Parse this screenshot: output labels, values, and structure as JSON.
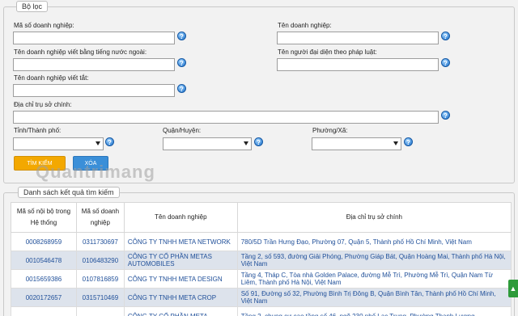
{
  "filter": {
    "legend": "Bộ lọc",
    "tax_code_label": "Mã số doanh nghiệp:",
    "name_label": "Tên doanh nghiệp:",
    "foreign_name_label": "Tên doanh nghiệp viết bằng tiếng nước ngoài:",
    "rep_label": "Tên người đại diện theo pháp luật:",
    "short_name_label": "Tên doanh nghiệp viết tắt:",
    "address_label": "Địa chỉ trụ sở chính:",
    "province_label": "Tỉnh/Thành phố:",
    "district_label": "Quận/Huyện:",
    "ward_label": "Phường/Xã:",
    "search_button": "TÌM KIẾM",
    "clear_button": "XÓA",
    "help_glyph": "?"
  },
  "watermark": "Quantrimang",
  "results": {
    "legend": "Danh sách kết quả tìm kiếm",
    "headers": [
      "Mã số nội bộ trong Hệ thống",
      "Mã số doanh nghiệp",
      "Tên doanh nghiệp",
      "Địa chỉ trụ sở chính"
    ],
    "rows": [
      [
        "0008268959",
        "0311730697",
        "CÔNG TY TNHH META NETWORK",
        "780/5D Trần Hưng Đạo, Phường 07, Quận 5, Thành phố Hồ Chí Minh, Việt Nam"
      ],
      [
        "0010546478",
        "0106483290",
        "CÔNG TY CỔ PHẦN METAS AUTOMOBILES",
        "Tầng 2, số 593, đường Giải Phóng, Phường Giáp Bát, Quận Hoàng Mai, Thành phố Hà Nội, Việt Nam"
      ],
      [
        "0015659386",
        "0107816859",
        "CÔNG TY TNHH META DESIGN",
        "Tầng 4, Tháp C, Tòa nhà Golden Palace, đường Mễ Trì, Phường Mễ Trì, Quận Nam Từ Liêm, Thành phố Hà Nội, Việt Nam"
      ],
      [
        "0020172657",
        "0315710469",
        "CÔNG TY TNHH META CROP",
        "Số 91, Đường số 32, Phường Bình Trị Đông B, Quận Bình Tân, Thành phố Hồ Chí Minh, Việt Nam"
      ],
      [
        "",
        "",
        "CÔNG TY CỔ PHẦN META",
        "Tầng 2, chung cư cao tầng số 46, ngõ 230 phố Lạc Trung, Phường Thanh Lương"
      ]
    ]
  },
  "side_tab_glyph": "▲"
}
